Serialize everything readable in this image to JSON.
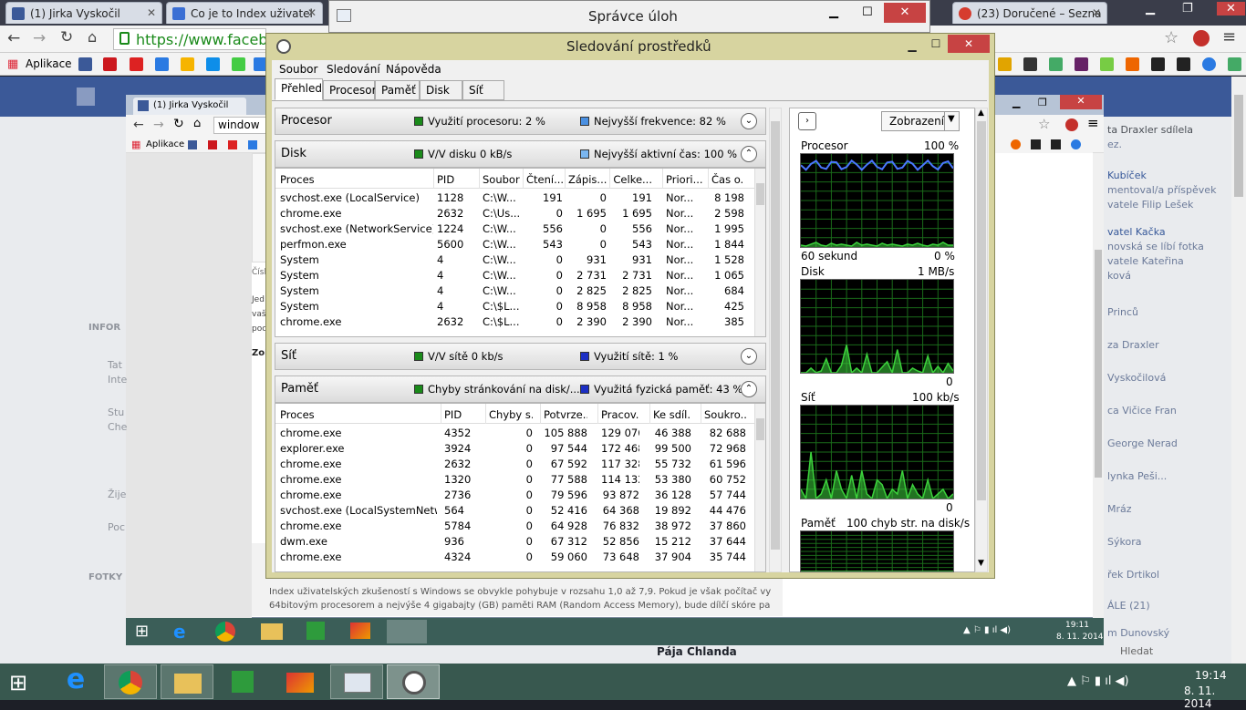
{
  "outer_chrome": {
    "tabs": [
      {
        "label": "(1) Jirka Vyskočil"
      },
      {
        "label": "Co je to Index uživatel"
      },
      {
        "label": "(23) Doručené – Sezna"
      }
    ],
    "url": "https://www.faceboo",
    "bookmarks_label": "Aplikace"
  },
  "task_manager": {
    "title": "Správce úloh"
  },
  "inner_chrome": {
    "tab": "(1) Jirka Vyskočil",
    "url": "window",
    "bookmarks_label": "Aplikace",
    "text_para": "Index uživatelských zkušeností s Windows se obvykle pohybuje v rozsahu 1,0 až 7,9. Pokud je však počítač vybaven",
    "text_para2": "64bitovým procesorem a nejvýše 4 gigabajty (GB) paměti RAM (Random Access Memory), bude dílčí skóre paměti RAM",
    "clock_time": "19:11",
    "clock_date": "8. 11. 2014"
  },
  "fb_right": [
    "ta Draxler sdílela",
    "ez.",
    "Kubíček",
    "mentoval/a příspěvek",
    "vatele Filip Lešek",
    "vatel Kačka",
    "novská se líbí fotka",
    "vatele Kateřina",
    "ková",
    "Princů",
    "za Draxler",
    "Vyskočilová",
    "ca Vičice Fran",
    "George Nerad",
    "lynka Peši...",
    "Mráz",
    "Sýkora",
    "řek Drtikol",
    "ÁLE (21)",
    "m Dunovský"
  ],
  "fb_left": [
    "Číslo",
    "Jed",
    "vaš",
    "poc",
    "Zol",
    "INFOR",
    "Tat",
    "Inte",
    "Stu",
    "Che",
    "Žije",
    "Poc",
    "FOTKY"
  ],
  "fb_bottom_name": "Pája Chlanda",
  "fb_bottom_right": "Hledat",
  "resmon": {
    "title": "Sledování prostředků",
    "menu": [
      "Soubor",
      "Sledování",
      "Nápověda"
    ],
    "tabs": [
      "Přehled",
      "Procesor",
      "Paměť",
      "Disk",
      "Síť"
    ],
    "sections": {
      "cpu": {
        "title": "Procesor",
        "stat1": "Využití procesoru: 2 %",
        "stat2": "Nejvyšší frekvence: 82 %"
      },
      "disk": {
        "title": "Disk",
        "stat1": "V/V disku 0 kB/s",
        "stat2": "Nejvyšší aktivní čas: 100 %"
      },
      "net": {
        "title": "Síť",
        "stat1": "V/V sítě 0 kb/s",
        "stat2": "Využití sítě: 1 %"
      },
      "mem": {
        "title": "Paměť",
        "stat1": "Chyby stránkování na disk/...",
        "stat2": "Využitá fyzická paměť: 43 %"
      }
    },
    "disk_table": {
      "headers": [
        "Proces",
        "PID",
        "Soubor",
        "Čtení...",
        "Zápis...",
        "Celke...",
        "Priori...",
        "Čas o..."
      ],
      "rows": [
        [
          "svchost.exe (LocalService)",
          "1128",
          "C:\\W...",
          "191",
          "0",
          "191",
          "Nor...",
          "8 198"
        ],
        [
          "chrome.exe",
          "2632",
          "C:\\Us...",
          "0",
          "1 695",
          "1 695",
          "Nor...",
          "2 598"
        ],
        [
          "svchost.exe (NetworkService)",
          "1224",
          "C:\\W...",
          "556",
          "0",
          "556",
          "Nor...",
          "1 995"
        ],
        [
          "perfmon.exe",
          "5600",
          "C:\\W...",
          "543",
          "0",
          "543",
          "Nor...",
          "1 844"
        ],
        [
          "System",
          "4",
          "C:\\W...",
          "0",
          "931",
          "931",
          "Nor...",
          "1 528"
        ],
        [
          "System",
          "4",
          "C:\\W...",
          "0",
          "2 731",
          "2 731",
          "Nor...",
          "1 065"
        ],
        [
          "System",
          "4",
          "C:\\W...",
          "0",
          "2 825",
          "2 825",
          "Nor...",
          "684"
        ],
        [
          "System",
          "4",
          "C:\\$L...",
          "0",
          "8 958",
          "8 958",
          "Nor...",
          "425"
        ],
        [
          "chrome.exe",
          "2632",
          "C:\\$L...",
          "0",
          "2 390",
          "2 390",
          "Nor...",
          "385"
        ]
      ]
    },
    "mem_table": {
      "headers": [
        "Proces",
        "PID",
        "Chyby s...",
        "Potvrze...",
        "Pracov...",
        "Ke sdíl...",
        "Soukro..."
      ],
      "rows": [
        [
          "chrome.exe",
          "4352",
          "0",
          "105 888",
          "129 076",
          "46 388",
          "82 688"
        ],
        [
          "explorer.exe",
          "3924",
          "0",
          "97 544",
          "172 468",
          "99 500",
          "72 968"
        ],
        [
          "chrome.exe",
          "2632",
          "0",
          "67 592",
          "117 328",
          "55 732",
          "61 596"
        ],
        [
          "chrome.exe",
          "1320",
          "0",
          "77 588",
          "114 132",
          "53 380",
          "60 752"
        ],
        [
          "chrome.exe",
          "2736",
          "0",
          "79 596",
          "93 872",
          "36 128",
          "57 744"
        ],
        [
          "svchost.exe (LocalSystemNetwo...",
          "564",
          "0",
          "52 416",
          "64 368",
          "19 892",
          "44 476"
        ],
        [
          "chrome.exe",
          "5784",
          "0",
          "64 928",
          "76 832",
          "38 972",
          "37 860"
        ],
        [
          "dwm.exe",
          "936",
          "0",
          "67 312",
          "52 856",
          "15 212",
          "37 644"
        ],
        [
          "chrome.exe",
          "4324",
          "0",
          "59 060",
          "73 648",
          "37 904",
          "35 744"
        ]
      ]
    },
    "right_panel": {
      "view_label": "Zobrazení",
      "cpu_label": "Procesor",
      "cpu_max": "100 %",
      "cpu_time": "60 sekund",
      "cpu_min": "0 %",
      "disk_label": "Disk",
      "disk_max": "1 MB/s",
      "disk_min": "0",
      "net_label": "Síť",
      "net_max": "100 kb/s",
      "net_min": "0",
      "mem_label": "Paměť",
      "mem_max": "100 chyb str. na disk/s"
    }
  },
  "taskbar": {
    "time": "19:14",
    "date": "8. 11. 2014"
  },
  "colors": {
    "resmon_frame": "#d7d4a0",
    "taskbar": "#38584f",
    "graph_green": "#3cd23c",
    "graph_blue": "#4a78ff"
  }
}
